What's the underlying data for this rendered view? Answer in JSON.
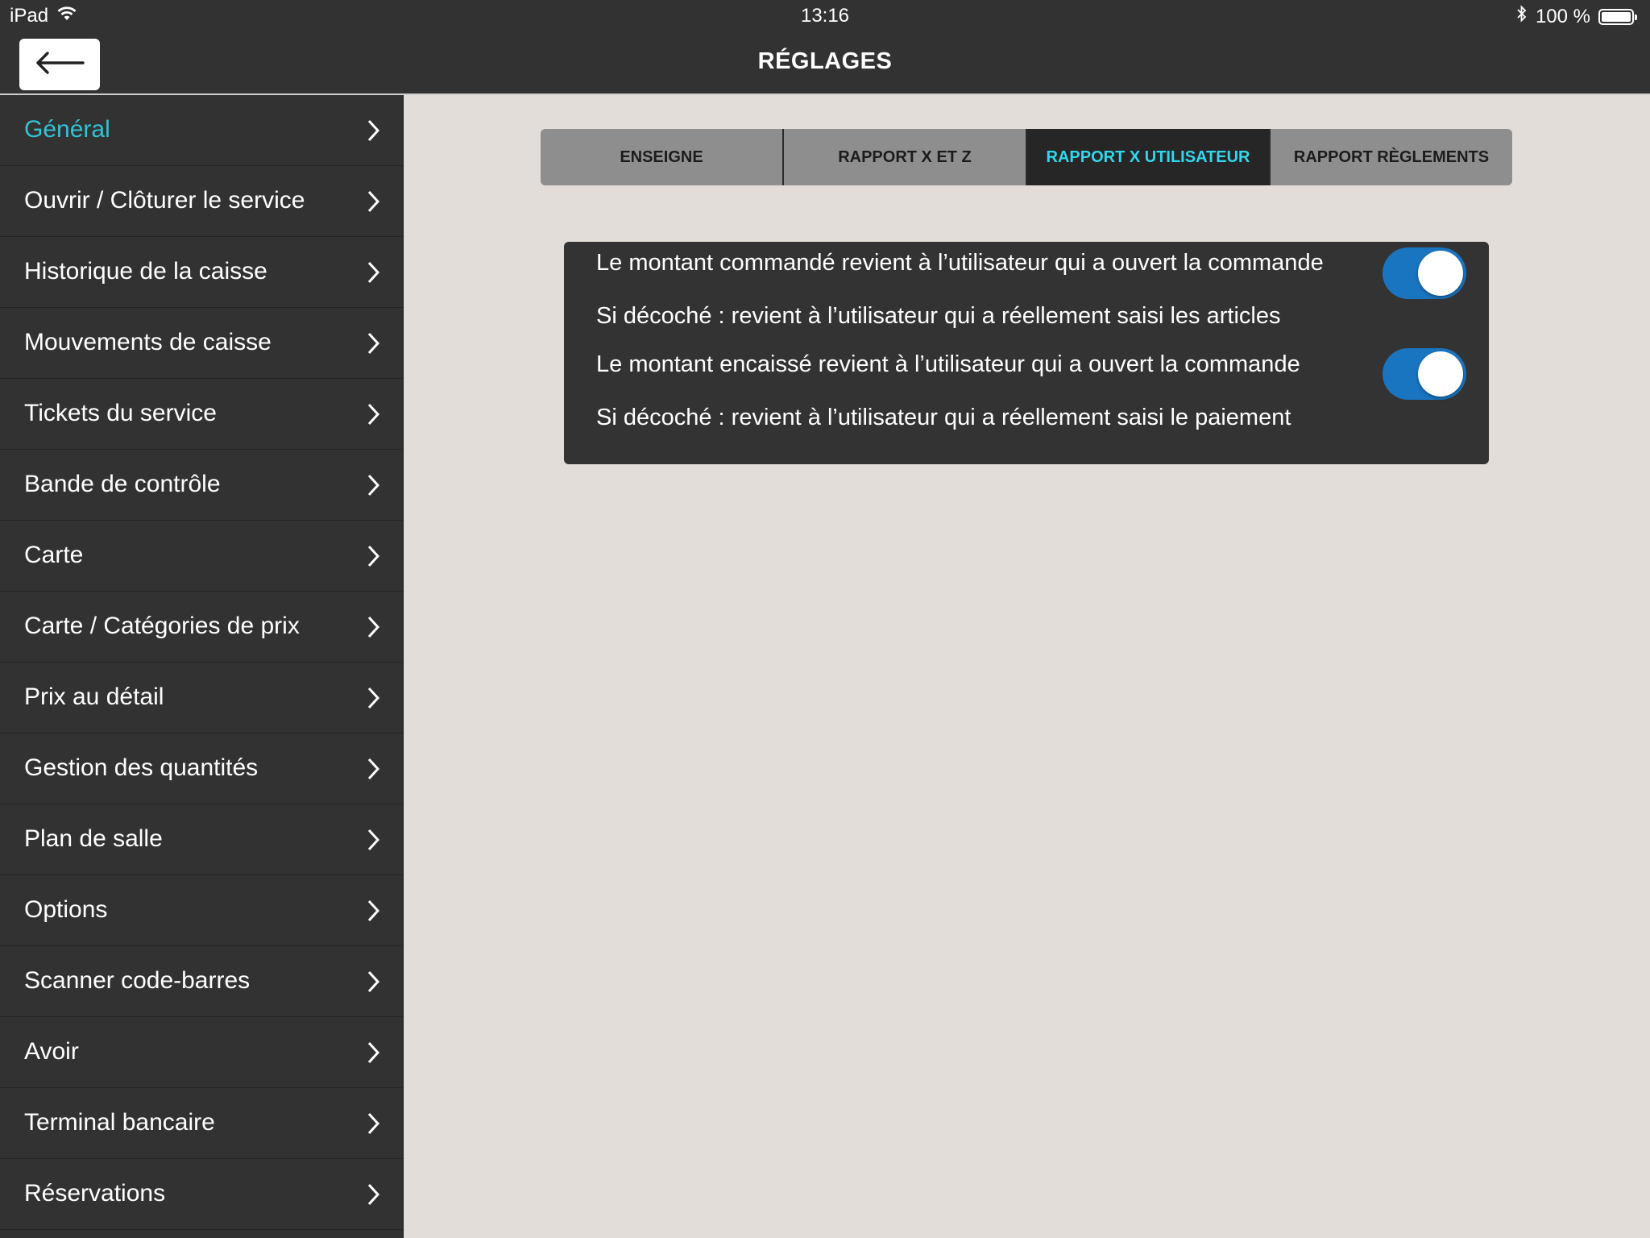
{
  "status_bar": {
    "device": "iPad",
    "time": "13:16",
    "battery": "100 %",
    "wifi_icon": "wifi-icon",
    "bluetooth_icon": "bluetooth-icon",
    "battery_icon": "battery-icon"
  },
  "nav": {
    "title": "RÉGLAGES",
    "back_icon": "arrow-left-icon"
  },
  "sidebar": {
    "items": [
      {
        "label": "Général",
        "active": true
      },
      {
        "label": "Ouvrir / Clôturer le service"
      },
      {
        "label": "Historique de la caisse"
      },
      {
        "label": "Mouvements de caisse"
      },
      {
        "label": "Tickets du service"
      },
      {
        "label": "Bande de contrôle"
      },
      {
        "label": "Carte"
      },
      {
        "label": "Carte / Catégories de prix"
      },
      {
        "label": "Prix au détail"
      },
      {
        "label": "Gestion des quantités"
      },
      {
        "label": "Plan de salle"
      },
      {
        "label": "Options"
      },
      {
        "label": "Scanner code-barres"
      },
      {
        "label": "Avoir"
      },
      {
        "label": "Terminal bancaire"
      },
      {
        "label": "Réservations"
      }
    ],
    "chevron_icon": "chevron-right-icon"
  },
  "tabs": [
    {
      "label": "ENSEIGNE"
    },
    {
      "label": "RAPPORT X ET Z"
    },
    {
      "label": "RAPPORT X UTILISATEUR",
      "active": true
    },
    {
      "label": "RAPPORT RÈGLEMENTS"
    }
  ],
  "settings": {
    "option1_label": "Le montant commandé revient à l’utilisateur qui a ouvert la commande",
    "option1_hint": "Si décoché : revient à l’utilisateur qui a réellement saisi les articles",
    "option1_on": true,
    "option2_label": "Le montant encaissé revient à l’utilisateur qui a ouvert la commande",
    "option2_hint": "Si décoché : revient à l’utilisateur qui a réellement saisi le paiement",
    "option2_on": true
  },
  "colors": {
    "accent": "#31c2d6",
    "toggle_on": "#1a75c1",
    "bar_bg": "#323232",
    "content_bg": "#e2ddd8"
  }
}
